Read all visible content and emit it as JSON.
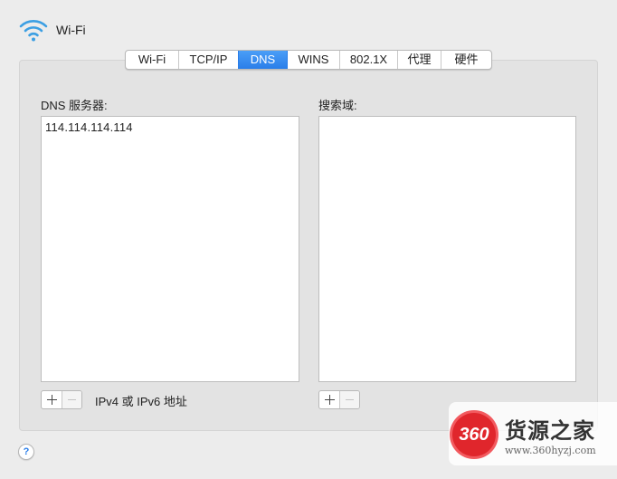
{
  "header": {
    "title": "Wi-Fi",
    "icon": "wifi-icon"
  },
  "tabs": [
    {
      "label": "Wi-Fi",
      "active": false
    },
    {
      "label": "TCP/IP",
      "active": false
    },
    {
      "label": "DNS",
      "active": true
    },
    {
      "label": "WINS",
      "active": false
    },
    {
      "label": "802.1X",
      "active": false
    },
    {
      "label": "代理",
      "active": false
    },
    {
      "label": "硬件",
      "active": false
    }
  ],
  "dns_servers": {
    "label": "DNS 服务器:",
    "entries": [
      "114.114.114.114"
    ],
    "hint": "IPv4 或 IPv6 地址"
  },
  "search_domains": {
    "label": "搜索域:",
    "entries": []
  },
  "buttons": {
    "add": "+",
    "remove": "−"
  },
  "help": {
    "glyph": "?"
  },
  "watermark": {
    "logo_text": "360",
    "title": "货源之家",
    "url": "www.360hyzj.com"
  },
  "colors": {
    "accent": "#2a7ee9",
    "logo_red": "#e0262c",
    "panel_bg": "#e3e3e3"
  }
}
